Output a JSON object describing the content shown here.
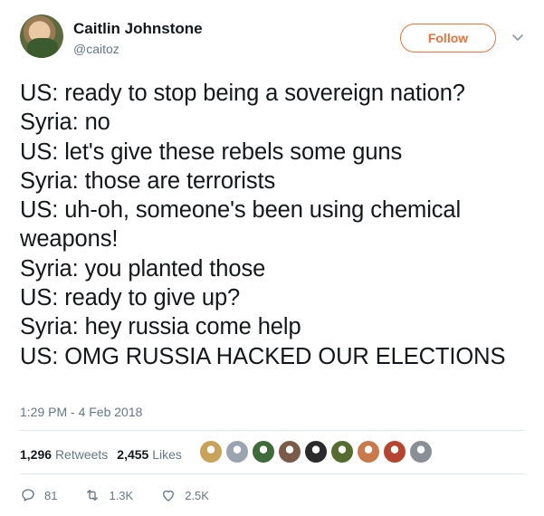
{
  "user": {
    "display_name": "Caitlin Johnstone",
    "handle": "@caitoz"
  },
  "follow_label": "Follow",
  "tweet": {
    "text": "US: ready to stop being a sovereign nation?\nSyria: no\nUS: let's give these rebels some guns\nSyria: those are terrorists\nUS: uh-oh, someone's been using chemical weapons!\nSyria: you planted those\nUS: ready to give up?\nSyria: hey russia come help\nUS: OMG RUSSIA HACKED OUR ELECTIONS",
    "timestamp": "1:29 PM - 4 Feb 2018"
  },
  "stats": {
    "retweets_count": "1,296",
    "retweets_label": "Retweets",
    "likes_count": "2,455",
    "likes_label": "Likes"
  },
  "liker_avatar_colors": [
    "#c9a25a",
    "#9aa5b1",
    "#3f6b3a",
    "#7a5b4a",
    "#2a2a2a",
    "#556b2f",
    "#c9794a",
    "#b5452f",
    "#8a8f96"
  ],
  "actions": {
    "reply_count": "81",
    "retweet_count": "1.3K",
    "like_count": "2.5K"
  },
  "colors": {
    "accent": "#e8743b",
    "secondary_text": "#657786"
  },
  "icons": [
    "caret-down-icon",
    "reply-icon",
    "retweet-icon",
    "heart-icon"
  ]
}
